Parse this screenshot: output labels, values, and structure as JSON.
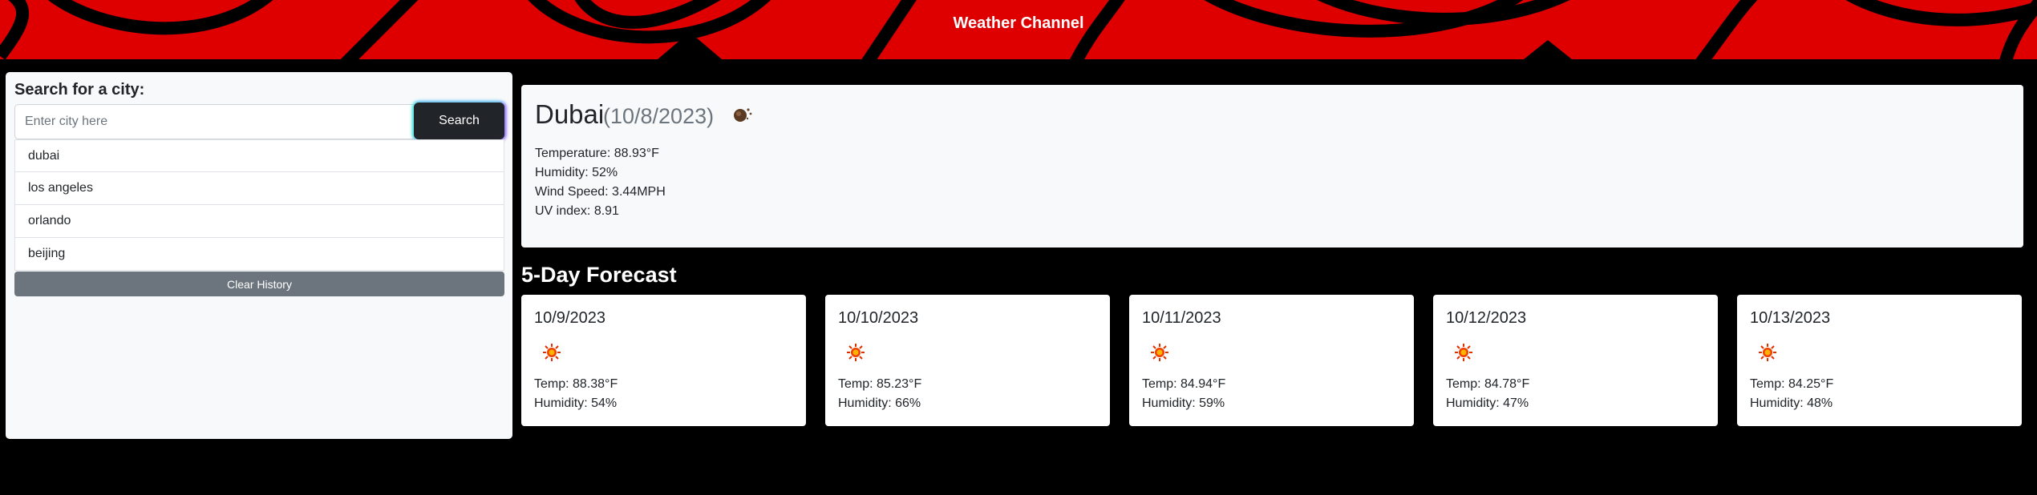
{
  "header": {
    "title": "Weather Channel",
    "brand_color": "#de0000"
  },
  "sidebar": {
    "label": "Search for a city:",
    "search_placeholder": "Enter city here",
    "search_button": "Search",
    "history": [
      "dubai",
      "los angeles",
      "orlando",
      "beijing"
    ],
    "clear_button": "Clear History"
  },
  "current": {
    "city": "Dubai",
    "date": "(10/8/2023)",
    "icon": "dust-haze-icon",
    "temperature": "Temperature: 88.93°F",
    "humidity": "Humidity: 52%",
    "wind": "Wind Speed: 3.44MPH",
    "uv": "UV index: 8.91"
  },
  "forecast": {
    "title": "5-Day Forecast",
    "days": [
      {
        "date": "10/9/2023",
        "icon": "sun-icon",
        "temp": "Temp: 88.38°F",
        "humidity": "Humidity: 54%"
      },
      {
        "date": "10/10/2023",
        "icon": "sun-icon",
        "temp": "Temp: 85.23°F",
        "humidity": "Humidity: 66%"
      },
      {
        "date": "10/11/2023",
        "icon": "sun-icon",
        "temp": "Temp: 84.94°F",
        "humidity": "Humidity: 59%"
      },
      {
        "date": "10/12/2023",
        "icon": "sun-icon",
        "temp": "Temp: 84.78°F",
        "humidity": "Humidity: 47%"
      },
      {
        "date": "10/13/2023",
        "icon": "sun-icon",
        "temp": "Temp: 84.25°F",
        "humidity": "Humidity: 48%"
      }
    ]
  }
}
